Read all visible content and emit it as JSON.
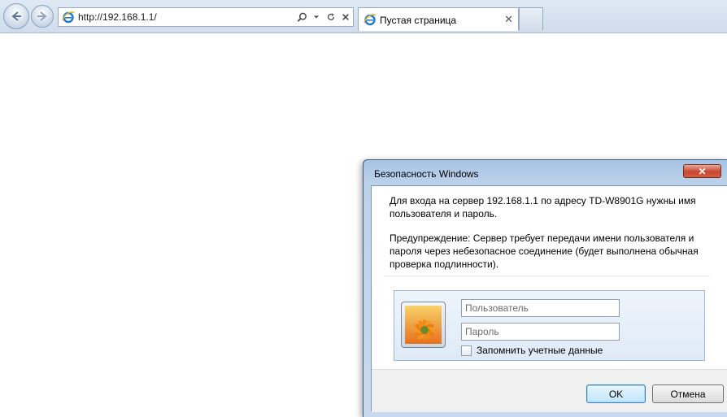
{
  "browser": {
    "address": "http://192.168.1.1/",
    "tab_title": "Пустая страница",
    "tab_close": "✕"
  },
  "dialog": {
    "title": "Безопасность Windows",
    "close_label": "✕",
    "message": "Для входа на сервер 192.168.1.1 по адресу TD-W8901G нужны имя пользователя и пароль.",
    "warning": "Предупреждение: Сервер требует передачи имени пользователя и пароля через небезопасное соединение (будет выполнена обычная проверка подлинности).",
    "username_placeholder": "Пользователь",
    "password_placeholder": "Пароль",
    "remember_label": "Запомнить учетные данные",
    "ok_label": "OK",
    "cancel_label": "Отмена"
  },
  "icons": {
    "back": "back-arrow-icon",
    "forward": "forward-arrow-icon",
    "ie": "internet-explorer-icon",
    "search": "search-icon",
    "dropdown": "chevron-down-icon",
    "refresh": "refresh-icon",
    "stop": "close-icon",
    "user": "user-avatar-flower-icon"
  },
  "colors": {
    "dialog_frame": "#bcd2ea",
    "close_button": "#c7462f",
    "ok_button": "#bee6fd"
  }
}
